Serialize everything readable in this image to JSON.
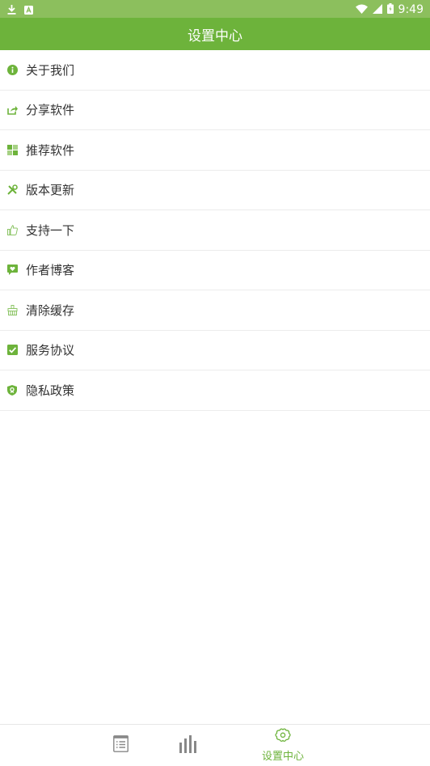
{
  "status_bar": {
    "time": "9:49"
  },
  "title": "设置中心",
  "menu": [
    {
      "label": "关于我们",
      "icon": "info-icon"
    },
    {
      "label": "分享软件",
      "icon": "share-icon"
    },
    {
      "label": "推荐软件",
      "icon": "apps-icon"
    },
    {
      "label": "版本更新",
      "icon": "tools-icon"
    },
    {
      "label": "支持一下",
      "icon": "thumbs-up-icon"
    },
    {
      "label": "作者博客",
      "icon": "heart-message-icon"
    },
    {
      "label": "清除缓存",
      "icon": "broom-icon"
    },
    {
      "label": "服务协议",
      "icon": "checkbox-icon"
    },
    {
      "label": "隐私政策",
      "icon": "shield-icon"
    }
  ],
  "bottom_nav": {
    "active_label": "设置中心"
  },
  "colors": {
    "accent": "#6db33b",
    "status_bar": "#8cbf5d"
  }
}
